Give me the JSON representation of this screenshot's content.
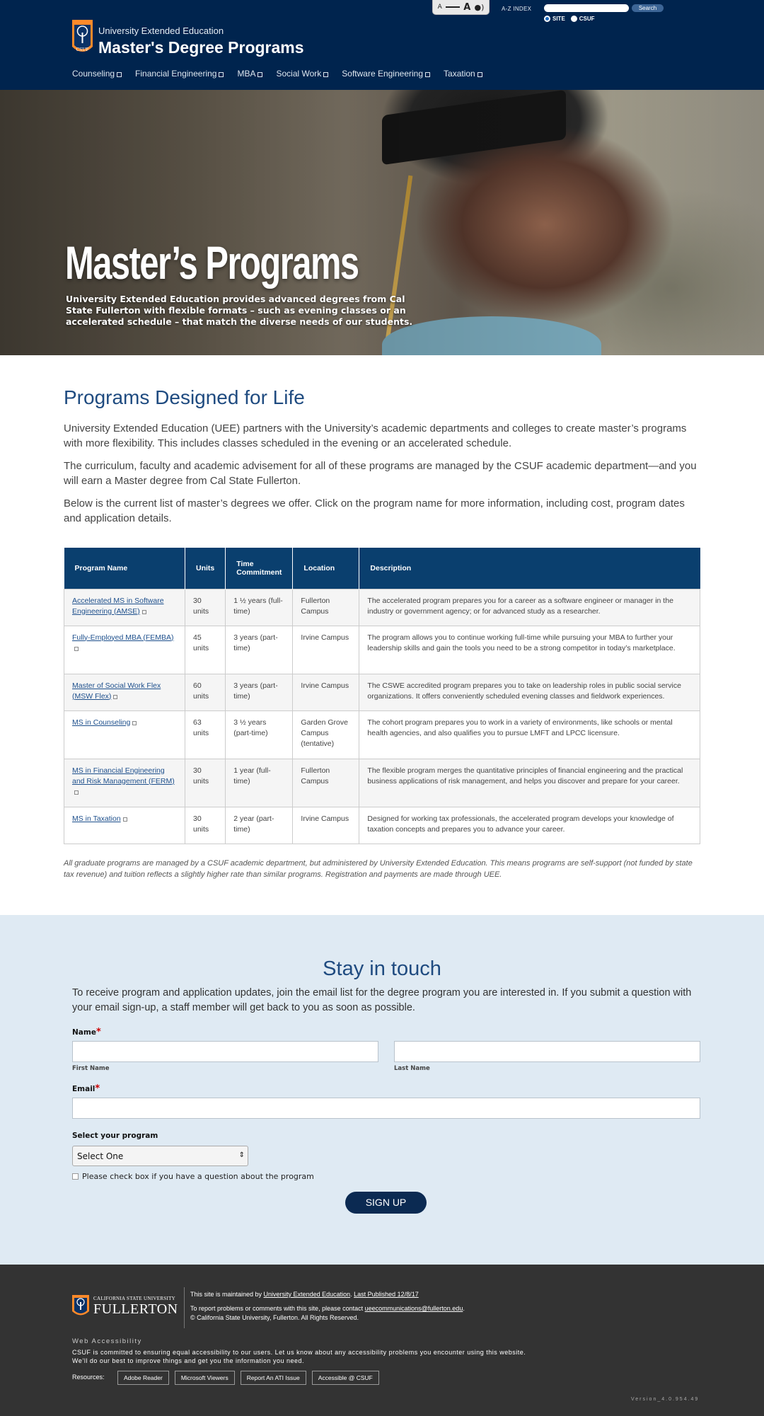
{
  "header": {
    "sub_title": "University Extended Education",
    "title": "Master's Degree Programs",
    "textsize_small": "A",
    "textsize_large": "A",
    "az_index": "A-Z INDEX",
    "search_label": "Search",
    "radio_site": "SITE",
    "radio_csuf": "CSUF",
    "logo_text": "CSUF",
    "nav": [
      "Counseling",
      "Financial Engineering",
      "MBA",
      "Social Work",
      "Software Engineering",
      "Taxation"
    ]
  },
  "hero": {
    "title": "Master’s Programs",
    "description": "University Extended Education provides advanced degrees from Cal State Fullerton with flexible formats – such as evening classes or an accelerated schedule – that match the diverse needs of our students."
  },
  "content": {
    "heading": "Programs Designed for Life",
    "p1": "University Extended Education (UEE) partners with the University’s academic departments and colleges to create master’s programs with more flexibility. This includes classes scheduled in the evening or an accelerated schedule.",
    "p2": "The curriculum, faculty and academic advisement for all of these programs are managed by the CSUF academic department—and you will earn a Master degree from Cal State Fullerton.",
    "p3": "Below is the current list of master’s degrees we offer. Click on the program name for more information, including cost, program dates and application details.",
    "table_headers": [
      "Program Name",
      "Units",
      "Time Commitment",
      "Location",
      "Description"
    ],
    "rows": [
      {
        "name": "Accelerated MS in Software Engineering (AMSE)",
        "units": "30 units",
        "time": "1 ½ years (full-time)",
        "location": "Fullerton Campus",
        "desc": "The accelerated program prepares you for a career as a software engineer or manager in the industry or government agency; or for advanced study as a researcher."
      },
      {
        "name": "Fully-Employed MBA (FEMBA)",
        "units": "45 units",
        "time": "3 years (part-time)",
        "location": "Irvine Campus",
        "desc": "The program allows you to continue working full-time while pursuing your MBA to further your leadership skills and gain the tools you need to be a strong competitor in today’s marketplace."
      },
      {
        "name": "Master of Social Work Flex (MSW Flex)",
        "units": "60 units",
        "time": "3 years (part-time)",
        "location": "Irvine Campus",
        "desc": "The CSWE accredited program prepares you to take on leadership roles in public social service organizations. It offers conveniently scheduled evening classes and fieldwork experiences."
      },
      {
        "name": "MS in Counseling",
        "units": "63 units",
        "time": "3 ½ years (part-time)",
        "location": "Garden Grove Campus (tentative)",
        "desc": "The cohort program prepares you to work in a variety of environments, like schools or mental health agencies, and also qualifies you to pursue LMFT and LPCC licensure."
      },
      {
        "name": "MS in Financial Engineering and Risk Management (FERM)",
        "units": "30 units",
        "time": "1 year (full-time)",
        "location": "Fullerton Campus",
        "desc": "The flexible program merges the quantitative principles of financial engineering and the practical business applications of risk management, and helps you discover and prepare for your career."
      },
      {
        "name": "MS in Taxation",
        "units": "30 units",
        "time": "2 year (part-time)",
        "location": "Irvine Campus",
        "desc": "Designed for working tax professionals, the accelerated program develops your knowledge of taxation concepts and prepares you to advance your career."
      }
    ],
    "footnote": "All graduate programs are managed by a CSUF academic department, but administered by University Extended Education. This means programs are self-support (not funded by state tax revenue) and tuition reflects a slightly higher rate than similar programs. Registration and payments are made through UEE."
  },
  "stay": {
    "title": "Stay in touch",
    "description": "To receive program and application updates, join the email list for the degree program you are interested in. If you submit a question with your email sign-up, a staff member will get back to you as soon as possible.",
    "name_label": "Name",
    "required_mark": "*",
    "first_name": "First Name",
    "last_name": "Last Name",
    "email_label": "Email",
    "program_label": "Select your program",
    "program_selected": "Select One",
    "checkbox_label": "Please check box if you have a question about the program",
    "signup": "SIGN UP"
  },
  "footer": {
    "logo_small": "CALIFORNIA STATE UNIVERSITY",
    "logo_big": "FULLERTON",
    "maintained_prefix": "This site is maintained by ",
    "maintained_link": "University Extended Education",
    "maintained_sep": ". ",
    "published": "Last Published 12/8/17",
    "report_prefix": "To report problems or comments with this site, please contact ",
    "report_email": "ueecommunications@fullerton.edu",
    "report_suffix": ".",
    "copyright": "© California State University, Fullerton. All Rights Reserved.",
    "acc_title": "Web Accessibility",
    "acc_line1": "CSUF is committed to ensuring equal accessibility to our users. Let us know about any accessibility problems you encounter using this website.",
    "acc_line2": "We’ll do our best to improve things and get you the information you need.",
    "resources": "Resources:",
    "buttons": [
      "Adobe Reader",
      "Microsoft Viewers",
      "Report An ATI Issue",
      "Accessible @ CSUF"
    ],
    "version": "Version_4.0.954.49"
  }
}
